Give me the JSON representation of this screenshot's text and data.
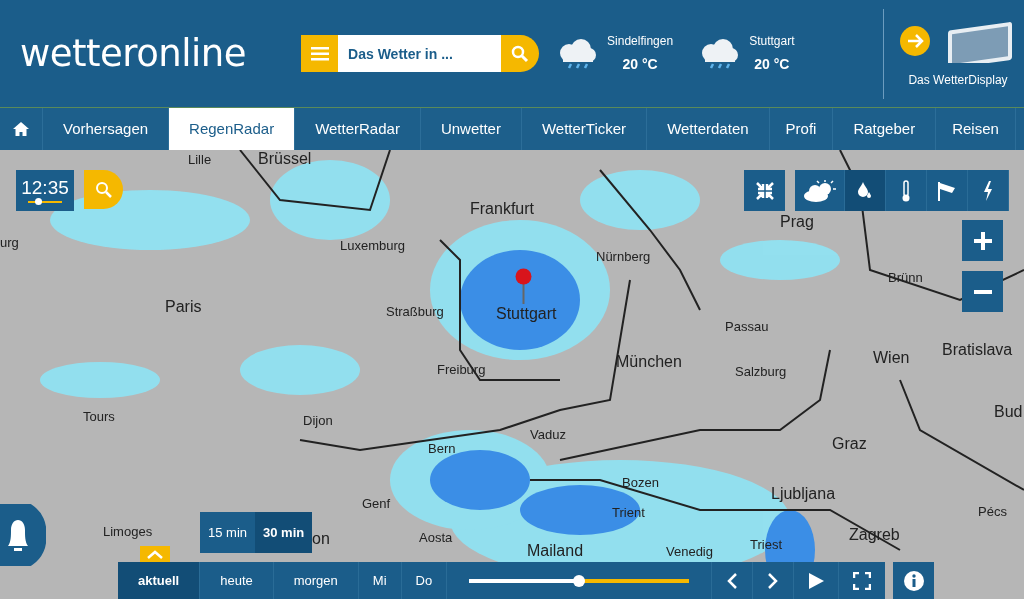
{
  "header": {
    "logo": "wetteronline",
    "search": {
      "placeholder": "Das Wetter in ..."
    },
    "forecasts": [
      {
        "city": "Sindelfingen",
        "temp": "20 °C"
      },
      {
        "city": "Stuttgart",
        "temp": "20 °C"
      }
    ],
    "promo": "Das WetterDisplay"
  },
  "nav": [
    {
      "label": "Vorhersagen",
      "selected": false
    },
    {
      "label": "RegenRadar",
      "selected": true
    },
    {
      "label": "WetterRadar",
      "selected": false
    },
    {
      "label": "Unwetter",
      "selected": false
    },
    {
      "label": "WetterTicker",
      "selected": false
    },
    {
      "label": "Wetterdaten",
      "selected": false
    },
    {
      "label": "Profi",
      "selected": false
    },
    {
      "label": "Ratgeber",
      "selected": false
    },
    {
      "label": "Reisen",
      "selected": false
    }
  ],
  "map": {
    "time_control": {
      "time": "12:35",
      "level": 0.3
    },
    "layers": [
      {
        "kind": "sun",
        "selected": false
      },
      {
        "kind": "rain",
        "selected": true
      },
      {
        "kind": "temperature",
        "selected": false
      },
      {
        "kind": "wind",
        "selected": false
      },
      {
        "kind": "lightning",
        "selected": false
      }
    ],
    "cities": [
      {
        "name": "Lille",
        "kind": "minor"
      },
      {
        "name": "Brüssel",
        "kind": "major"
      },
      {
        "name": "Frankfurt",
        "kind": "major"
      },
      {
        "name": "Prag",
        "kind": "major"
      },
      {
        "name": "urg",
        "kind": "minor"
      },
      {
        "name": "Luxemburg",
        "kind": "minor"
      },
      {
        "name": "Nürnberg",
        "kind": "minor"
      },
      {
        "name": "Brünn",
        "kind": "minor"
      },
      {
        "name": "Paris",
        "kind": "major"
      },
      {
        "name": "Straßburg",
        "kind": "minor"
      },
      {
        "name": "Stuttgart",
        "kind": "major"
      },
      {
        "name": "Passau",
        "kind": "minor"
      },
      {
        "name": "München",
        "kind": "major"
      },
      {
        "name": "Wien",
        "kind": "major"
      },
      {
        "name": "Bratislava",
        "kind": "major"
      },
      {
        "name": "Freiburg",
        "kind": "minor"
      },
      {
        "name": "Salzburg",
        "kind": "minor"
      },
      {
        "name": "Tours",
        "kind": "minor"
      },
      {
        "name": "Dijon",
        "kind": "minor"
      },
      {
        "name": "Bud",
        "kind": "major"
      },
      {
        "name": "Bern",
        "kind": "minor"
      },
      {
        "name": "Vaduz",
        "kind": "minor"
      },
      {
        "name": "Graz",
        "kind": "major"
      },
      {
        "name": "Bozen",
        "kind": "minor"
      },
      {
        "name": "Ljubljana",
        "kind": "major"
      },
      {
        "name": "Genf",
        "kind": "minor"
      },
      {
        "name": "Trient",
        "kind": "minor"
      },
      {
        "name": "Pécs",
        "kind": "minor"
      },
      {
        "name": "Limoges",
        "kind": "minor"
      },
      {
        "name": "on",
        "kind": "major"
      },
      {
        "name": "Aosta",
        "kind": "minor"
      },
      {
        "name": "Triest",
        "kind": "minor"
      },
      {
        "name": "Zagreb",
        "kind": "major"
      },
      {
        "name": "Mailand",
        "kind": "major"
      },
      {
        "name": "Venedig",
        "kind": "minor"
      }
    ],
    "intervals": [
      {
        "label": "15 min",
        "selected": false
      },
      {
        "label": "30 min",
        "selected": true
      }
    ],
    "days": [
      {
        "label": "aktuell",
        "selected": true
      },
      {
        "label": "heute",
        "selected": false
      },
      {
        "label": "morgen",
        "selected": false
      },
      {
        "label": "Mi",
        "selected": false
      },
      {
        "label": "Do",
        "selected": false
      }
    ],
    "timeline": {
      "level": 0.5
    }
  }
}
